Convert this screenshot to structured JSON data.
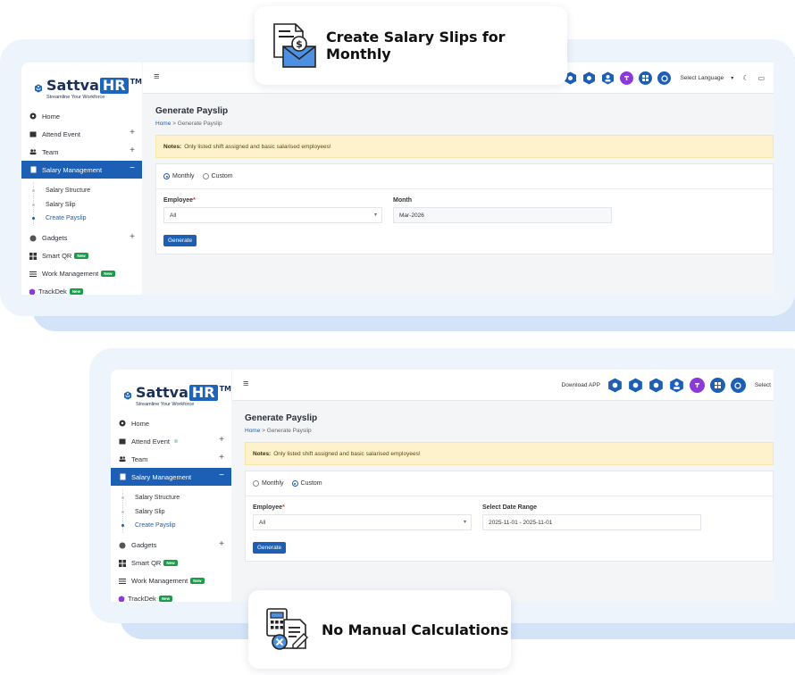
{
  "callout_top": {
    "text": "Create Salary Slips for  Monthly",
    "icon": "salary-envelope-icon"
  },
  "callout_bottom": {
    "text": "No Manual Calculations",
    "icon": "calculator-document-icon"
  },
  "logo": {
    "brand": "Sattva",
    "brand_hr": "HR",
    "tm": "TM",
    "tagline": "Streamline Your Workforce"
  },
  "nav": {
    "home": "Home",
    "attend_event": "Attend Event",
    "team": "Team",
    "salary_management": "Salary Management",
    "salary_structure": "Salary Structure",
    "salary_slip": "Salary Slip",
    "create_payslip": "Create Payslip",
    "gadgets": "Gadgets",
    "smart_qr": "Smart QR",
    "work_management": "Work Management",
    "trackdek": "TrackDek",
    "new_badge": "New",
    "plus": "+",
    "minus": "−"
  },
  "topbar": {
    "menu_icon": "≡",
    "select_language": "Select Language",
    "select_short": "Select",
    "download_app": "Download APP"
  },
  "page": {
    "title": "Generate Payslip",
    "crumb_home": "Home",
    "crumb_sep": " > ",
    "crumb_current": "Generate Payslip",
    "notes_label": "Notes:",
    "notes_text": "Only listed shift assigned and basic salarised employees!",
    "radio_monthly": "Monthly",
    "radio_custom": "Custom",
    "employee_label": "Employee",
    "required_mark": "*",
    "employee_value": "All",
    "month_label": "Month",
    "month_value": "Mar-2026",
    "date_range_label": "Select Date Range",
    "date_range_value": "2025-11-01 - 2025-11-01",
    "generate_button": "Generate"
  },
  "colors": {
    "primary": "#1c5fb4",
    "notes_bg": "#fdf2cc",
    "badge": "#1a9c4a"
  }
}
